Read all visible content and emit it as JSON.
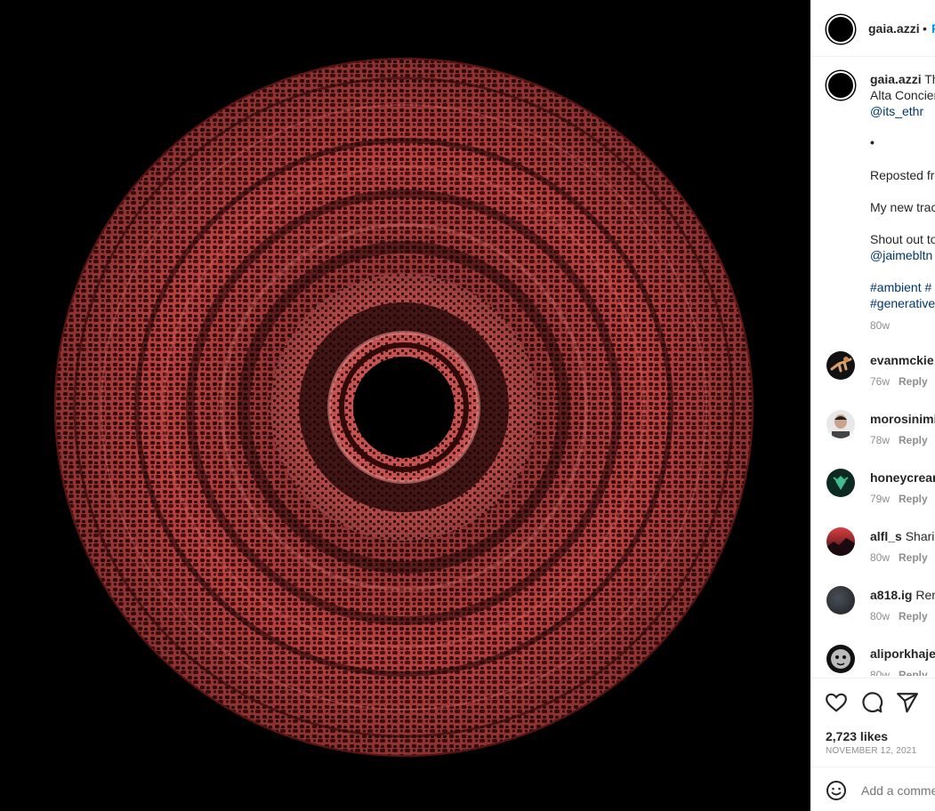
{
  "post": {
    "author": "gaia.azzi",
    "header_separator": "•",
    "follow_label": "F"
  },
  "caption": {
    "author": "gaia.azzi",
    "line1_text": "Th",
    "line2_text": "Alta Concier",
    "mention1": "@its_ethr",
    "dot": "•",
    "reposted": "Reposted fr",
    "new_track": "My new trac",
    "shout_out": "Shout out to",
    "mention2": "@jaimebltn",
    "hashtags_line1": "#ambient #",
    "hashtags_line2": "#generative",
    "time": "80w"
  },
  "comments": [
    {
      "user": "evanmckie",
      "text": "",
      "time": "76w",
      "reply": "Reply"
    },
    {
      "user": "morosinimi",
      "text": "",
      "time": "78w",
      "reply": "Reply"
    },
    {
      "user": "honeycrean",
      "text": "",
      "time": "79w",
      "reply": "Reply"
    },
    {
      "user": "alfl_s",
      "text": "Sharin",
      "time": "80w",
      "reply": "Reply"
    },
    {
      "user": "a818.ig",
      "text": "Rem",
      "time": "80w",
      "reply": "Reply"
    },
    {
      "user": "aliporkhaje",
      "text": "",
      "time": "80w",
      "reply": "Reply"
    }
  ],
  "actions": {
    "likes": "2,723 likes",
    "date": "NOVEMBER 12, 2021",
    "add_comment_placeholder": "Add a comment..."
  },
  "colors": {
    "disc": "#b8413f",
    "link": "#00376b",
    "follow": "#0095f6"
  },
  "icons": [
    "heart-icon",
    "comment-icon",
    "share-icon",
    "emoji-icon"
  ]
}
